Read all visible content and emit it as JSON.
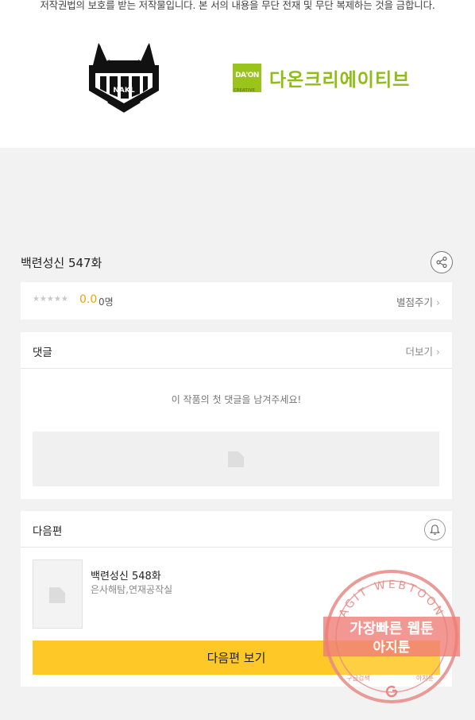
{
  "notice": {
    "copyright_text": "저작권법의 보호를 받는 저작물입니다. 본 서의 내용을 무단 전재 및 무단 복제하는 것을 금합니다."
  },
  "logos": {
    "left": {
      "icon": "nakl-logo-icon"
    },
    "right": {
      "badge_text": "DA'ON",
      "badge_sub": "CREATIVE",
      "name": "다온크리에이티브",
      "color": "#8fbc17"
    }
  },
  "episode": {
    "title": "백련성신 547화",
    "share_icon": "share-icon"
  },
  "rating": {
    "stars": "★★★★★",
    "score": "0.0",
    "count": "0명",
    "rate_label": "별점주기",
    "score_color": "#f0a500"
  },
  "comments": {
    "title": "댓글",
    "more_label": "더보기",
    "empty_message": "이 작품의 첫 댓글을 남겨주세요!"
  },
  "next": {
    "title": "다음편",
    "bell_icon": "bell-icon",
    "episode_title": "백련성신 548화",
    "author": "은사해탐,연재공작실",
    "button_label": "다음편 보기",
    "button_color": "#fec827"
  },
  "watermark": {
    "arc_text": "AGIT WEBTOON",
    "line1": "가장빠른 웹툰",
    "line2": "아지툰",
    "bottom_left": "구글검색",
    "bottom_right": "아지툰",
    "color": "#e8403a"
  }
}
